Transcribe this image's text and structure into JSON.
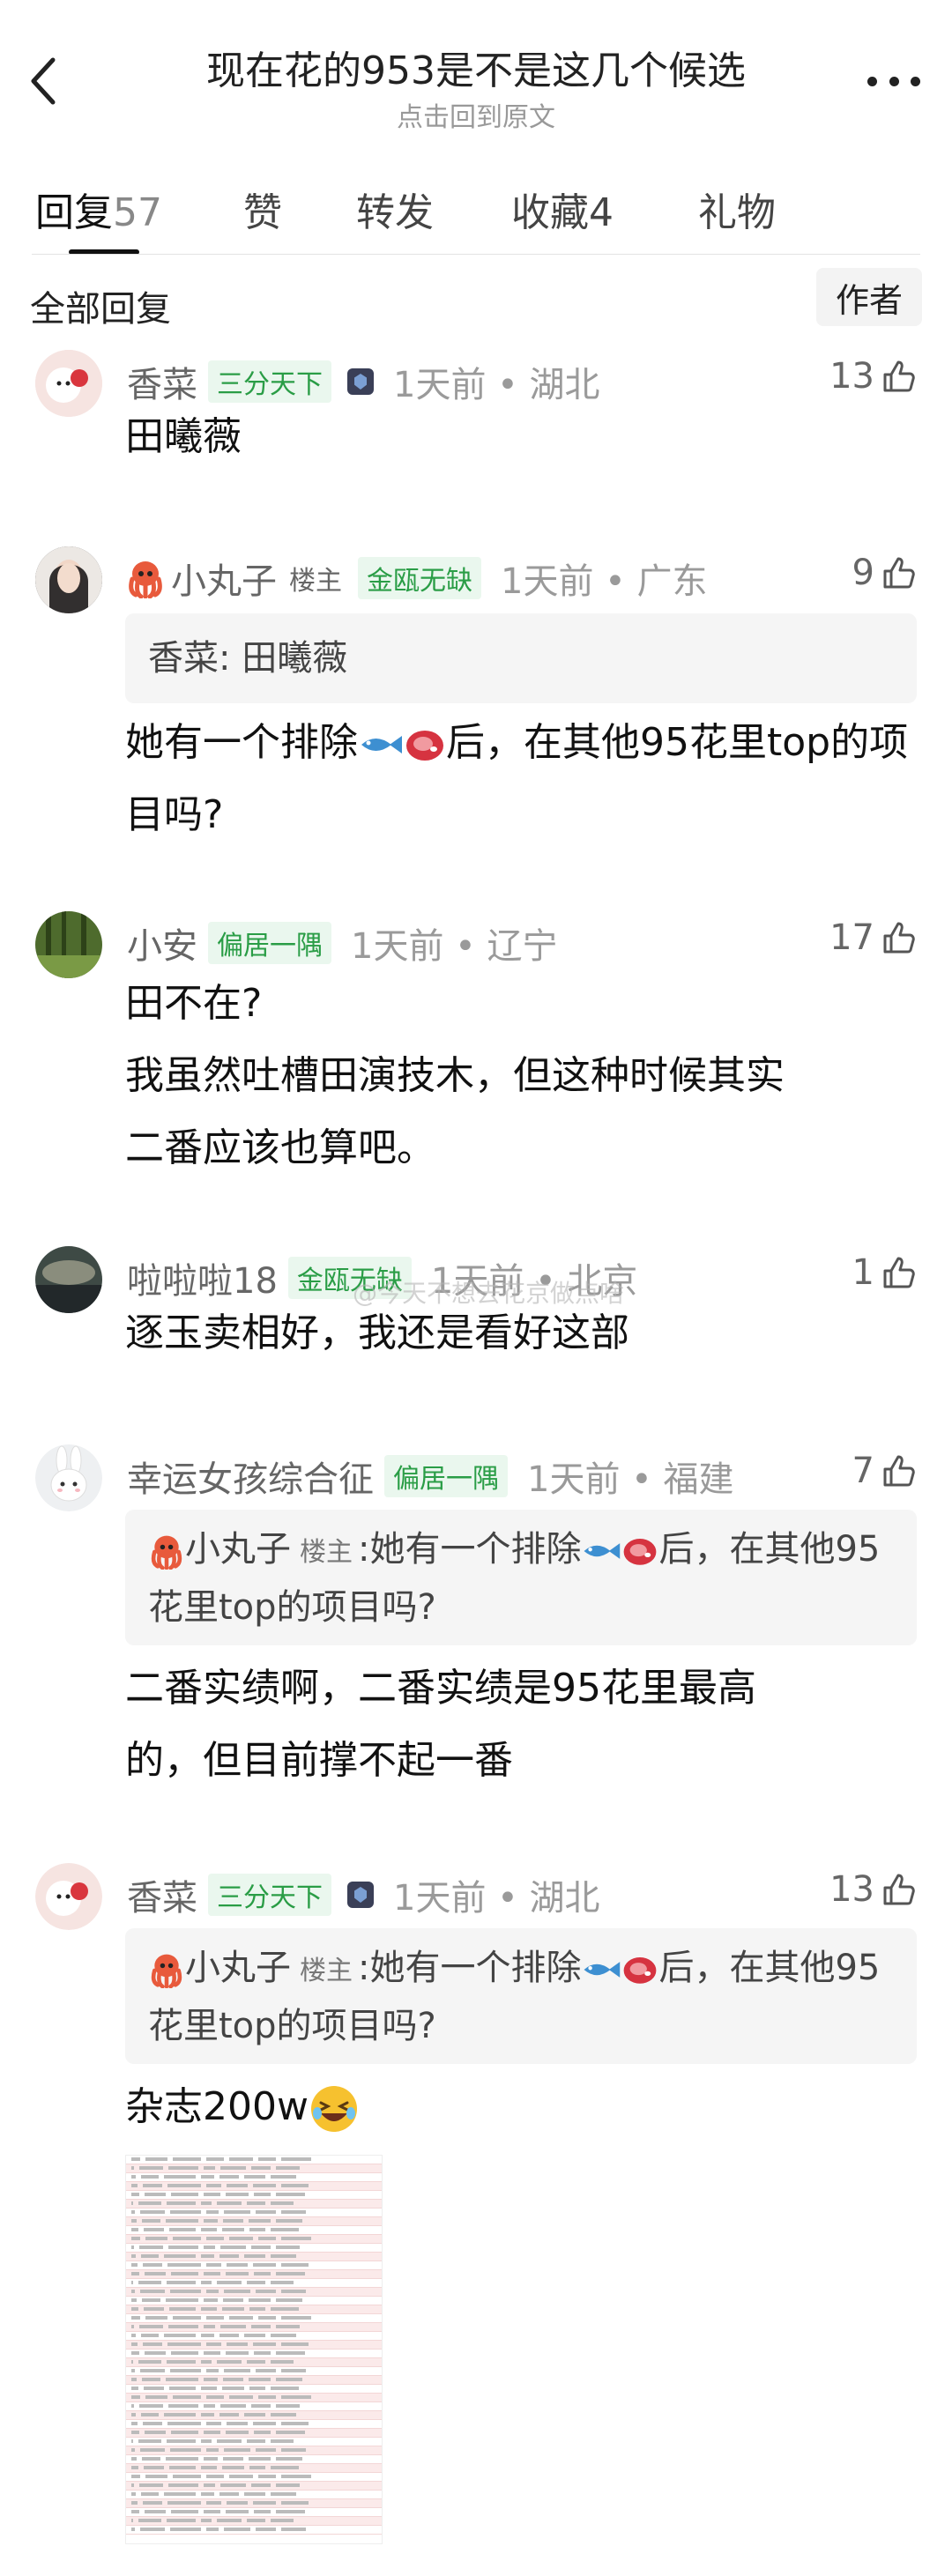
{
  "header": {
    "title": "现在花的953是不是这几个候选",
    "subtitle": "点击回到原文"
  },
  "tabs": [
    {
      "label": "回复",
      "count": "57"
    },
    {
      "label": "赞",
      "count": ""
    },
    {
      "label": "转发",
      "count": ""
    },
    {
      "label": "收藏",
      "count": "4"
    },
    {
      "label": "礼物",
      "count": ""
    }
  ],
  "section": {
    "all_label": "全部回复",
    "author_button": "作者"
  },
  "watermark": "@今天不想去花京做点啥",
  "comments": [
    {
      "user": "香菜",
      "badge": "三分天下",
      "time": "1天前 • 湖北",
      "likes": "13",
      "text": "田曦薇"
    },
    {
      "user": "小丸子",
      "owner_tag": "楼主",
      "badge": "金瓯无缺",
      "time": "1天前 • 广东",
      "likes": "9",
      "quote": "香菜: 田曦薇",
      "text_before": "她有一个排除",
      "text_after": "后，在其他95花里top的项目吗?"
    },
    {
      "user": "小安",
      "badge": "偏居一隅",
      "time": "1天前 • 辽宁",
      "likes": "17",
      "lines": [
        "田不在?",
        "我虽然吐槽田演技木，但这种时候其实",
        "二番应该也算吧。"
      ]
    },
    {
      "user": "啦啦啦18",
      "badge": "金瓯无缺",
      "time": "1天前 • 北京",
      "likes": "1",
      "text": "逐玉卖相好，我还是看好这部"
    },
    {
      "user": "幸运女孩综合征",
      "badge": "偏居一隅",
      "time": "1天前 • 福建",
      "likes": "7",
      "quote_user": "小丸子",
      "quote_owner": "楼主",
      "quote_before": ":她有一个排除",
      "quote_after": "后，在其他95花里top的项目吗?",
      "lines": [
        "二番实绩啊，二番实绩是95花里最高",
        "的，但目前撑不起一番"
      ]
    },
    {
      "user": "香菜",
      "badge": "三分天下",
      "time": "1天前 • 湖北",
      "likes": "13",
      "quote_user": "小丸子",
      "quote_owner": "楼主",
      "quote_before": ":她有一个排除",
      "quote_after": "后，在其他95花里top的项目吗?",
      "text": "杂志200w"
    }
  ]
}
